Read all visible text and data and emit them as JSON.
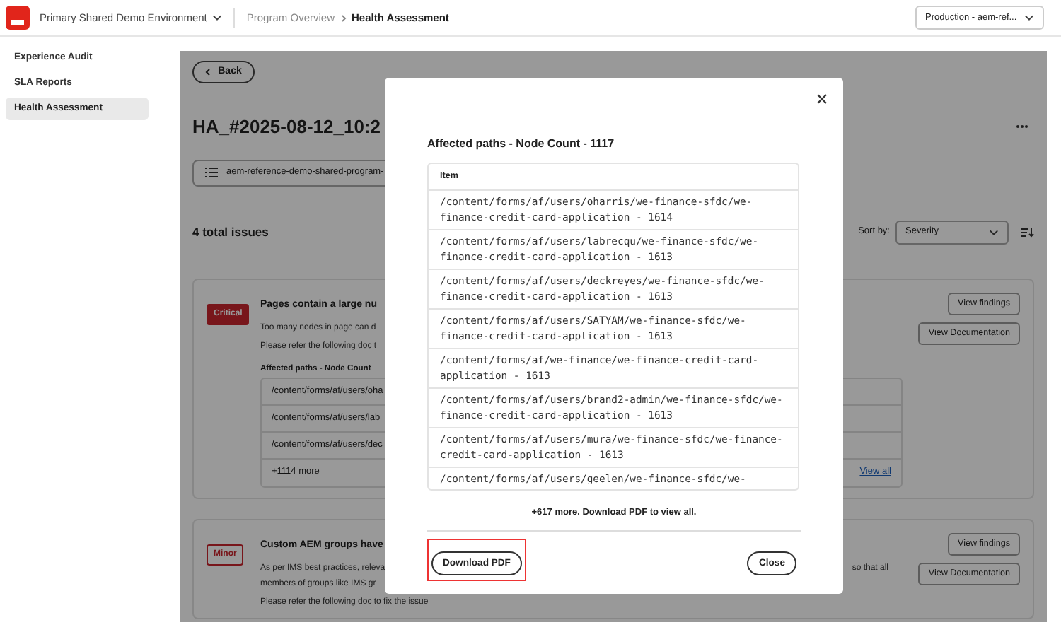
{
  "header": {
    "environment": "Primary Shared Demo Environment",
    "breadcrumb": [
      {
        "label": "Program Overview",
        "current": false
      },
      {
        "label": "Health Assessment",
        "current": true
      }
    ],
    "env_select": "Production - aem-ref..."
  },
  "sidebar": {
    "items": [
      {
        "label": "Experience Audit",
        "selected": false
      },
      {
        "label": "SLA Reports",
        "selected": false
      },
      {
        "label": "Health Assessment",
        "selected": true
      }
    ]
  },
  "main": {
    "back": "Back",
    "title": "HA_#2025-08-12_10:2",
    "program_select": "aem-reference-demo-shared-program-",
    "total": "4 total issues",
    "sort_label": "Sort by:",
    "sort_value": "Severity",
    "issues": [
      {
        "severity": "Critical",
        "kind": "critical",
        "title": "Pages contain a large nu",
        "lines": [
          "Too many nodes in page can d"
        ],
        "note": "Please refer the following doc t",
        "paths_label": "Affected paths - Node Count",
        "paths": [
          "/content/forms/af/users/oha",
          "/content/forms/af/users/lab",
          "/content/forms/af/users/dec"
        ],
        "more": "+1114 more",
        "view_all": "View all",
        "buttons": [
          "View findings",
          "View Documentation"
        ]
      },
      {
        "severity": "Minor",
        "kind": "minor",
        "title": "Custom AEM groups have",
        "lines": [
          "As per IMS best practices, releva",
          "members of groups like IMS gr"
        ],
        "note": "Please refer the following doc to fix the issue",
        "line_right": "so that all",
        "buttons": [
          "View findings",
          "View Documentation"
        ]
      }
    ]
  },
  "modal": {
    "title": "Affected paths - Node Count - 1117",
    "column": "Item",
    "rows": [
      "/content/forms/af/users/oharris/we-finance-sfdc/we-finance-credit-card-application - 1614",
      "/content/forms/af/users/labrecqu/we-finance-sfdc/we-finance-credit-card-application - 1613",
      "/content/forms/af/users/deckreyes/we-finance-sfdc/we-finance-credit-card-application - 1613",
      "/content/forms/af/users/SATYAM/we-finance-sfdc/we-finance-credit-card-application - 1613",
      "/content/forms/af/we-finance/we-finance-credit-card-application - 1613",
      "/content/forms/af/users/brand2-admin/we-finance-sfdc/we-finance-credit-card-application - 1613",
      "/content/forms/af/users/mura/we-finance-sfdc/we-finance-credit-card-application - 1613",
      "/content/forms/af/users/geelen/we-finance-sfdc/we-"
    ],
    "more": "+617 more. Download PDF to view all.",
    "buttons": [
      {
        "label": "Download PDF",
        "highlighted": true
      },
      {
        "label": "Close",
        "highlighted": false
      }
    ]
  }
}
